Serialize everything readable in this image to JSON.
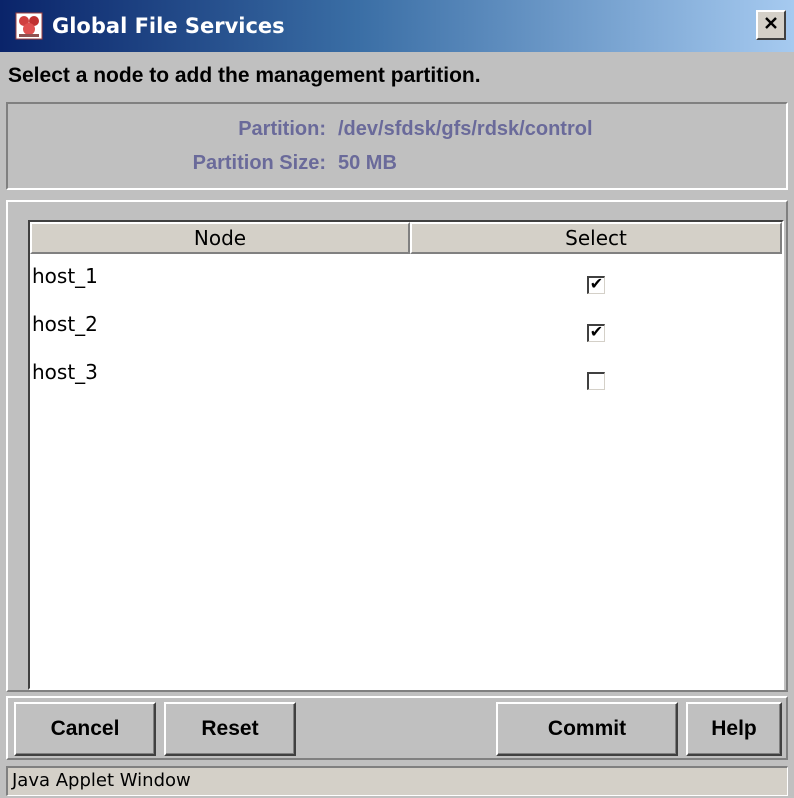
{
  "window": {
    "title": "Global File Services",
    "close_glyph": "✕",
    "app_icon": "gfs-app-icon"
  },
  "instruction": "Select a node to add the management partition.",
  "info": {
    "partition_label": "Partition:",
    "partition_value": "/dev/sfdsk/gfs/rdsk/control",
    "size_label": "Partition Size:",
    "size_value": "50 MB",
    "text_color": "#6a6a9a"
  },
  "table": {
    "columns": [
      "Node",
      "Select"
    ],
    "rows": [
      {
        "node": "host_1",
        "selected": true,
        "mark": "✔"
      },
      {
        "node": "host_2",
        "selected": true,
        "mark": "✔"
      },
      {
        "node": "host_3",
        "selected": false,
        "mark": ""
      }
    ]
  },
  "buttons": {
    "cancel": "Cancel",
    "reset": "Reset",
    "commit": "Commit",
    "help": "Help"
  },
  "status": "Java Applet Window",
  "colors": {
    "title_bar_start": "#0a246a",
    "title_bar_end": "#a6caf0",
    "face": "#c0c0c0"
  }
}
